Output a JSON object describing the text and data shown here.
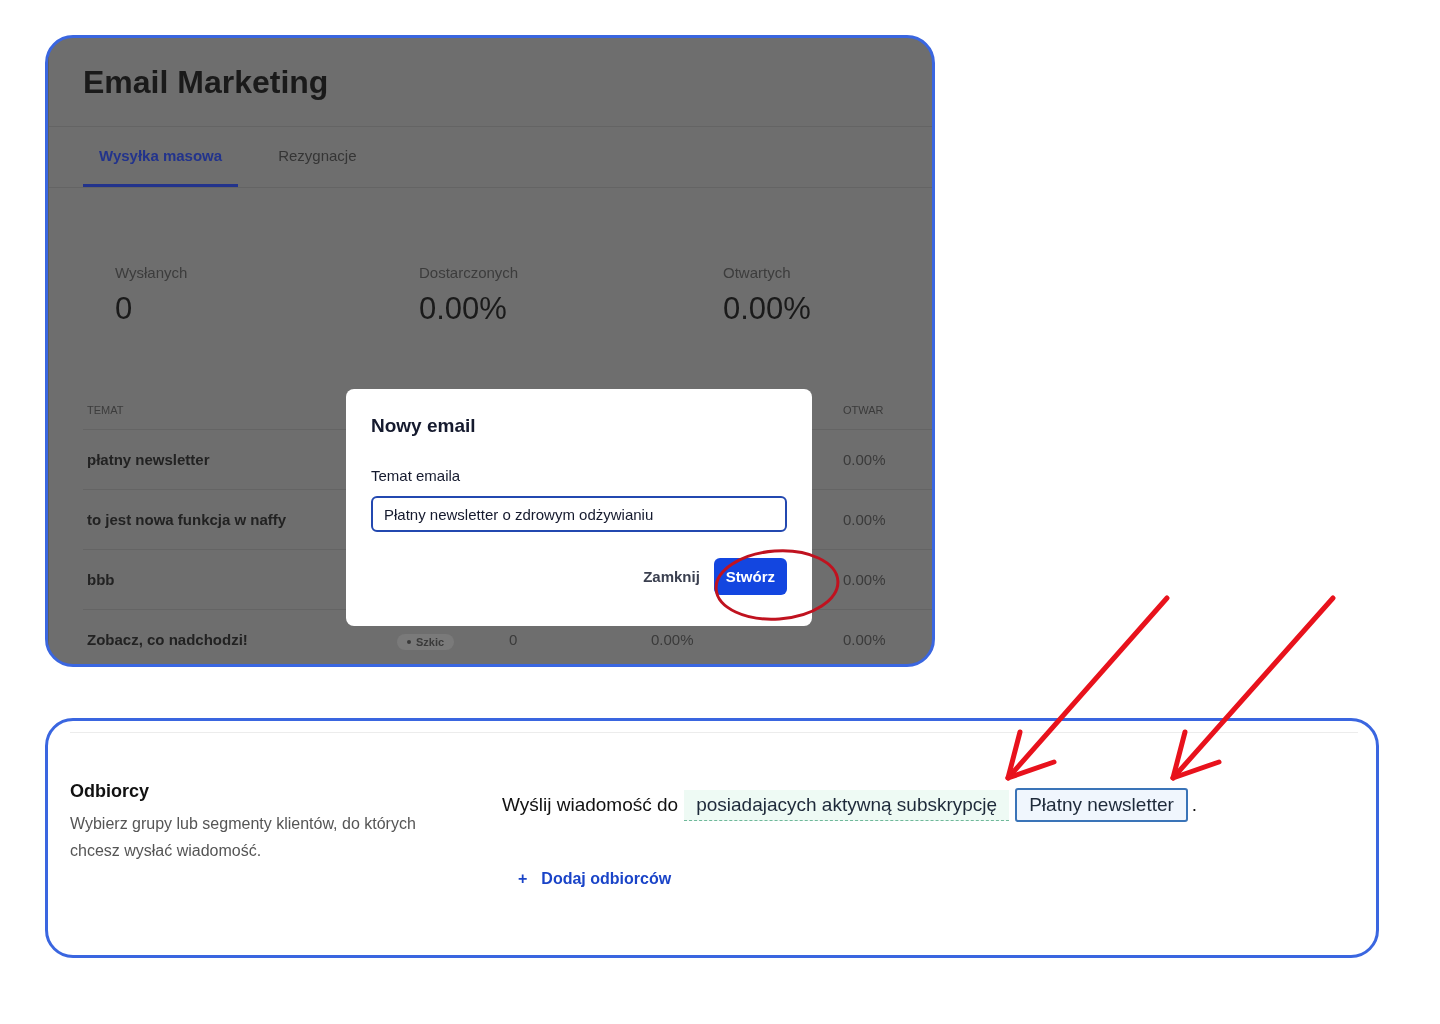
{
  "app": {
    "title": "Email Marketing",
    "tabs": [
      {
        "label": "Wysyłka masowa",
        "selected": true
      },
      {
        "label": "Rezygnacje",
        "selected": false
      }
    ],
    "stats": [
      {
        "label": "Wysłanych",
        "value": "0"
      },
      {
        "label": "Dostarczonych",
        "value": "0.00%"
      },
      {
        "label": "Otwartych",
        "value": "0.00%"
      }
    ],
    "table": {
      "columns": [
        "TEMAT",
        "OTWAR"
      ],
      "rows": [
        {
          "cells": [
            {
              "text": "płatny newsletter",
              "kind": "text"
            },
            {
              "text": "0.00%",
              "kind": "text"
            }
          ]
        },
        {
          "cells": [
            {
              "text": "to jest nowa funkcja w naffy",
              "kind": "text"
            },
            {
              "text": "0.00%",
              "kind": "text"
            }
          ]
        },
        {
          "cells": [
            {
              "text": "bbb",
              "kind": "text"
            },
            {
              "text": "0.00%",
              "kind": "text"
            }
          ]
        },
        {
          "cells": [
            {
              "text": "Zobacz, co nadchodzi!",
              "kind": "text"
            },
            {
              "text": "Szkic",
              "kind": "badge"
            },
            {
              "text": "0",
              "kind": "text"
            },
            {
              "text": "0.00%",
              "kind": "text"
            },
            {
              "text": "0.00%",
              "kind": "text"
            }
          ]
        }
      ]
    }
  },
  "dialog": {
    "title": "Nowy email",
    "field_label": "Temat emaila",
    "field_value": "Płatny newsletter o zdrowym odżywianiu",
    "buttons": [
      {
        "label": "Zamknij",
        "kind": "text"
      },
      {
        "label": "Stwórz",
        "kind": "primary"
      }
    ]
  },
  "recipients": {
    "title": "Odbiorcy",
    "description": "Wybierz grupy lub segmenty klientów, do których chcesz wysłać wiadomość.",
    "sentence_start": "Wyślij wiadomość do",
    "chips": [
      {
        "label": "posiadajacych aktywną subskrypcję",
        "kind": "condition"
      },
      {
        "label": "Płatny newsletter",
        "kind": "segment"
      }
    ],
    "sentence_end": ".",
    "add_link": {
      "icon": "+",
      "label": "Dodaj odbiorców"
    }
  }
}
